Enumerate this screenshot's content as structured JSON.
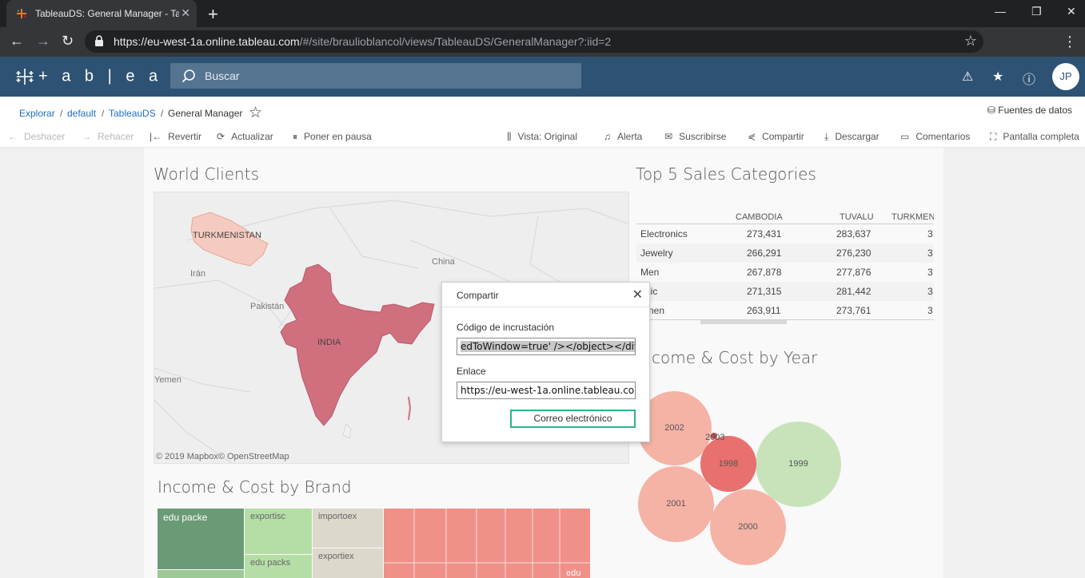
{
  "browser": {
    "tab_title": "TableauDS: General Manager - Ta",
    "url_host": "https://eu-west-1a.online.tableau.com",
    "url_path": "/#/site/braulioblancol/views/TableauDS/GeneralManager?:iid=2"
  },
  "header": {
    "logo": "+ a b | e a u",
    "search_placeholder": "Buscar",
    "avatar": "JP"
  },
  "breadcrumb": {
    "items": [
      "Explorar",
      "default",
      "TableauDS",
      "General Manager"
    ],
    "datasources": "Fuentes de datos"
  },
  "toolbar": {
    "undo": "Deshacer",
    "redo": "Rehacer",
    "revert": "Revertir",
    "refresh": "Actualizar",
    "pause": "Poner en pausa",
    "view": "Vista: Original",
    "alert": "Alerta",
    "subscribe": "Suscribirse",
    "share": "Compartir",
    "download": "Descargar",
    "comments": "Comentarios",
    "fullscreen": "Pantalla completa"
  },
  "map": {
    "title": "World Clients",
    "labels": {
      "turkmenistan": "TURKMENISTAN",
      "china": "China",
      "iran": "Irán",
      "pakistan": "Pakistán",
      "india": "INDIA",
      "yemen": "Yemen"
    },
    "copyright": "© 2019 Mapbox© OpenStreetMap"
  },
  "table": {
    "title": "Top 5 Sales Categories",
    "columns": [
      "CAMBODIA",
      "TUVALU",
      "TURKMEN"
    ],
    "rows": [
      {
        "cat": "Electronics",
        "v1": "273,431",
        "v2": "283,637",
        "v3": "3"
      },
      {
        "cat": "Jewelry",
        "v1": "266,291",
        "v2": "276,230",
        "v3": "3"
      },
      {
        "cat": "Men",
        "v1": "267,878",
        "v2": "277,876",
        "v3": "3"
      },
      {
        "cat": "usic",
        "v1": "271,315",
        "v2": "281,442",
        "v3": "3"
      },
      {
        "cat": "omen",
        "v1": "263,911",
        "v2": "273,761",
        "v3": "3"
      }
    ]
  },
  "dialog": {
    "title": "Compartir",
    "embed_label": "Código de incrustación",
    "embed_value": "edToWindow=true' /></object></div>",
    "link_label": "Enlace",
    "link_value": "https://eu-west-1a.online.tableau.com/",
    "email_button": "Correo electrónico"
  },
  "bubbles": {
    "title": "come & Cost by Year",
    "years": [
      "2002",
      "2003",
      "1998",
      "1999",
      "2001",
      "2000"
    ]
  },
  "treemap": {
    "title": "Income & Cost by Brand",
    "labels": [
      "edu packe",
      "exportisc",
      "importoex",
      "edu packs",
      "exportiex",
      "edu"
    ]
  },
  "colors": {
    "header": "#2e5273",
    "accent": "#2cb38b",
    "india": "#d0707f",
    "turkmenistan": "#f6cbbf"
  }
}
